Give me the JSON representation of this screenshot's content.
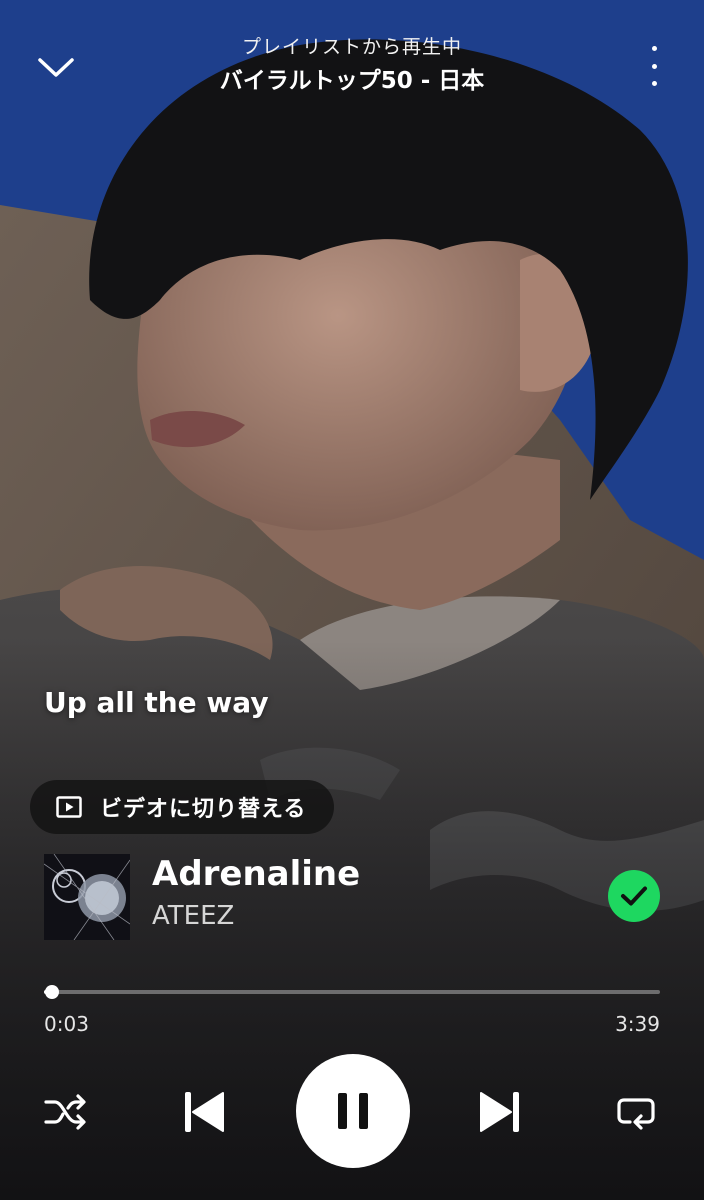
{
  "header": {
    "context_label": "プレイリストから再生中",
    "playlist_name": "バイラルトップ50 - 日本"
  },
  "lyric": {
    "line": "Up all the way"
  },
  "video_toggle": {
    "label": "ビデオに切り替える"
  },
  "track": {
    "title": "Adrenaline",
    "artist": "ATEEZ",
    "saved": true
  },
  "playback": {
    "elapsed": "0:03",
    "duration": "3:39",
    "progress_fraction": 0.0137,
    "state": "playing"
  },
  "icons": {
    "collapse": "chevron-down-icon",
    "more": "more-vertical-icon",
    "video": "play-box-icon",
    "saved": "check-circle-icon",
    "shuffle": "shuffle-icon",
    "previous": "skip-previous-icon",
    "pause": "pause-icon",
    "next": "skip-next-icon",
    "repeat": "repeat-icon"
  },
  "colors": {
    "accent_green": "#1ed760",
    "sky_blue": "#1e3f8c"
  }
}
